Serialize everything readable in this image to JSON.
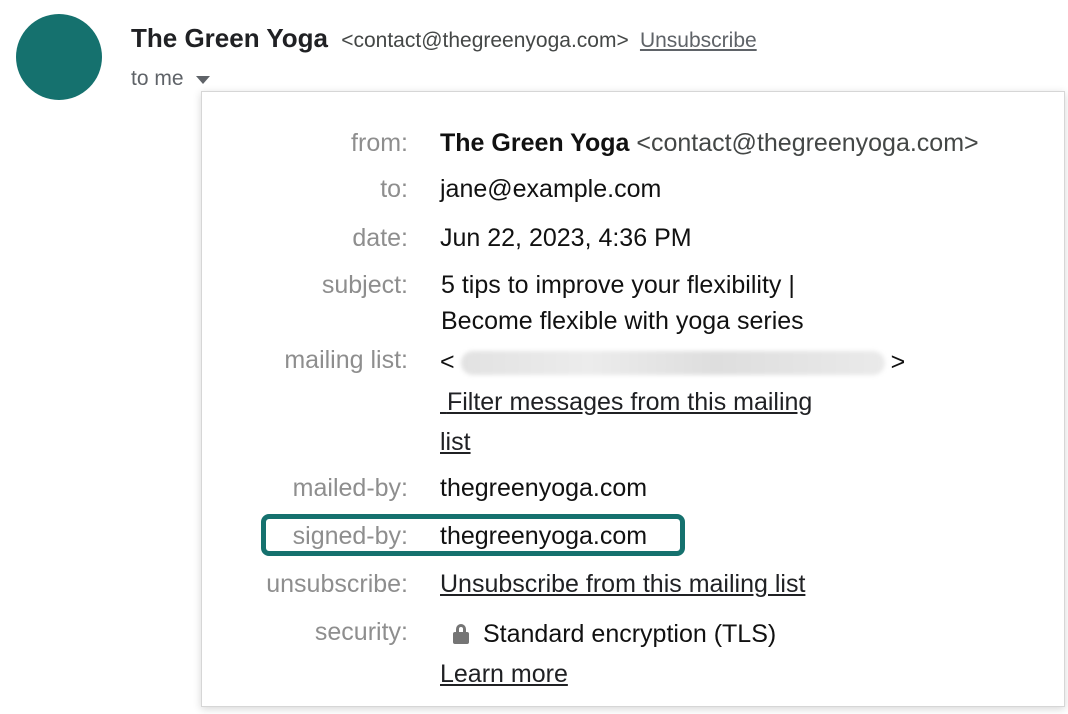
{
  "header": {
    "sender_name": "The Green Yoga",
    "sender_email": "<contact@thegreenyoga.com>",
    "unsubscribe_label": "Unsubscribe",
    "recipient_label": "to me"
  },
  "details": {
    "from": {
      "label": "from:",
      "name": "The Green Yoga",
      "email": "<contact@thegreenyoga.com>"
    },
    "to": {
      "label": "to:",
      "value": "jane@example.com"
    },
    "date": {
      "label": "date:",
      "value": "Jun 22, 2023, 4:36 PM"
    },
    "subject": {
      "label": "subject:",
      "line1": "5 tips to improve your flexibility |",
      "line2": "Become flexible with yoga series"
    },
    "mailing_list": {
      "label": "mailing list:",
      "open_bracket": "<",
      "close_bracket": ">",
      "filter_line1": "Filter messages from this mailing",
      "filter_line2": "list"
    },
    "mailed_by": {
      "label": "mailed-by:",
      "value": "thegreenyoga.com"
    },
    "signed_by": {
      "label": "signed-by:",
      "value": "thegreenyoga.com"
    },
    "unsubscribe": {
      "label": "unsubscribe:",
      "value": "Unsubscribe from this mailing list"
    },
    "security": {
      "label": "security:",
      "value": "Standard encryption (TLS)",
      "learn_more": "Learn more"
    }
  },
  "colors": {
    "avatar": "#15716e",
    "highlight": "#15716e",
    "label_gray": "#8e8e8e"
  },
  "icons": {
    "dropdown": "caret-down-icon",
    "security": "lock-icon"
  }
}
